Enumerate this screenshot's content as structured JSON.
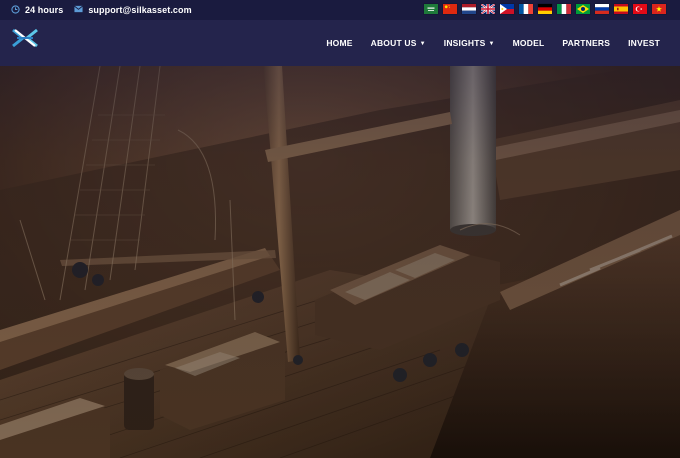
{
  "topbar": {
    "hours_icon": "clock-icon",
    "hours_text": "24 hours",
    "email_icon": "envelope-icon",
    "email_text": "support@silkasset.com",
    "languages": [
      {
        "name": "arabic-flag"
      },
      {
        "name": "chinese-flag"
      },
      {
        "name": "dutch-flag"
      },
      {
        "name": "english-flag"
      },
      {
        "name": "filipino-flag"
      },
      {
        "name": "french-flag"
      },
      {
        "name": "german-flag"
      },
      {
        "name": "italian-flag"
      },
      {
        "name": "portuguese-flag"
      },
      {
        "name": "russian-flag"
      },
      {
        "name": "spanish-flag"
      },
      {
        "name": "turkish-flag"
      },
      {
        "name": "vietnamese-flag"
      }
    ]
  },
  "nav": {
    "logo": "silkasset-logo",
    "items": [
      {
        "label": "HOME"
      },
      {
        "label": "ABOUT US",
        "dropdown": true
      },
      {
        "label": "INSIGHTS",
        "dropdown": true
      },
      {
        "label": "MODEL"
      },
      {
        "label": "PARTNERS"
      },
      {
        "label": "INVEST"
      }
    ]
  },
  "colors": {
    "topbar_bg": "#1a1b3f",
    "navbar_bg": "#24244c",
    "icon_accent": "#5c9bd6",
    "nav_text": "#ffffff"
  },
  "hero": {
    "image": "sailing-ship-model-deck"
  }
}
